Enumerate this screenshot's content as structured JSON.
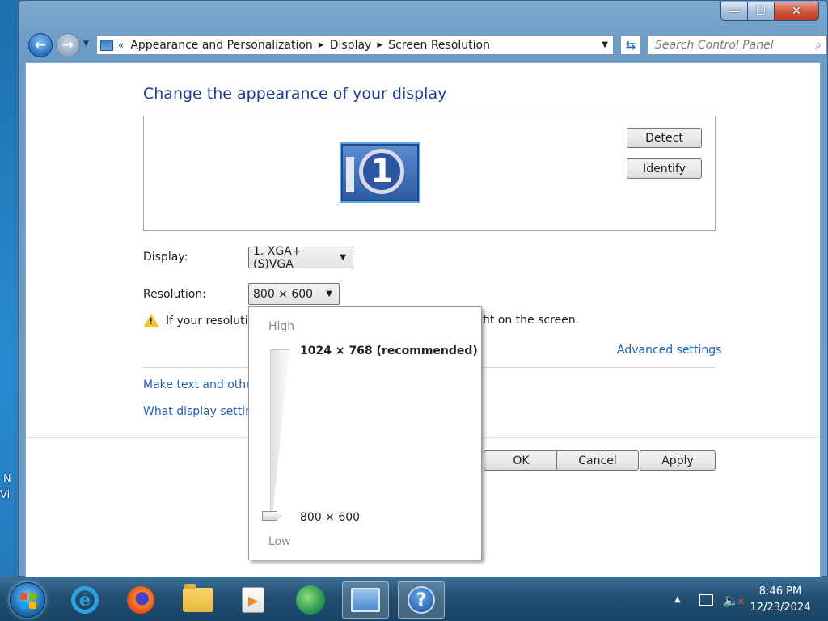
{
  "desktop": {
    "label_partial_1": "N",
    "label_partial_2": "Vi"
  },
  "window": {
    "caption": {
      "minimize": "—",
      "maximize": "☐",
      "close": "✕"
    },
    "address": {
      "overflow": "«",
      "crumbs": [
        "Appearance and Personalization",
        "Display",
        "Screen Resolution"
      ]
    },
    "search": {
      "placeholder": "Search Control Panel"
    }
  },
  "page": {
    "heading": "Change the appearance of your display",
    "monitor_number": "1",
    "detect_label": "Detect",
    "identify_label": "Identify",
    "display_label": "Display:",
    "display_value": "1. XGA+(S)VGA",
    "resolution_label": "Resolution:",
    "resolution_value": "800 × 600",
    "warning_start": "If your resolutio",
    "warning_end": "fit on the screen.",
    "advanced_link": "Advanced settings",
    "link_text_size": "Make text and othe",
    "link_display_settings": "What display setting",
    "ok_label": "OK",
    "cancel_label": "Cancel",
    "apply_label": "Apply"
  },
  "resolution_popup": {
    "high_label": "High",
    "low_label": "Low",
    "options": [
      {
        "label": "1024 × 768 (recommended)"
      },
      {
        "label": "800 × 600"
      }
    ],
    "selected": "800 × 600"
  },
  "taskbar": {
    "items": [
      "internet-explorer",
      "firefox",
      "file-explorer",
      "media-player",
      "messenger",
      "control-panel",
      "help"
    ],
    "clock_time": "8:46 PM",
    "clock_date": "12/23/2024"
  },
  "colors": {
    "heading": "#1e3d8c",
    "link": "#1f5eb4",
    "taskbar": "#224e72"
  }
}
